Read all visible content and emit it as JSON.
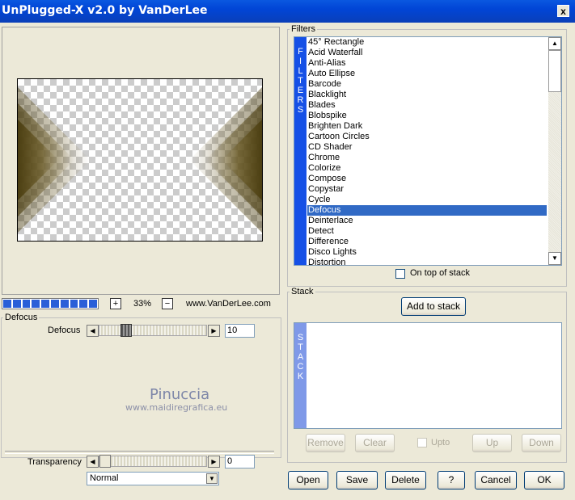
{
  "window": {
    "title": "UnPlugged-X v2.0 by VanDerLee",
    "close_label": "x"
  },
  "preview": {
    "zoom": "33%",
    "zoom_in": "+",
    "zoom_out": "−",
    "website": "www.VanDerLee.com",
    "progress_segments": 10
  },
  "params": {
    "group_label": "Defocus",
    "defocus": {
      "label": "Defocus",
      "value": "10"
    },
    "transparency": {
      "label": "Transparency",
      "value": "0"
    },
    "blend_mode": "Normal"
  },
  "watermark": {
    "name": "Pinuccia",
    "url": "www.maidiregrafica.eu"
  },
  "filters": {
    "group_label": "Filters",
    "strip_letters": [
      "F",
      "I",
      "L",
      "T",
      "E",
      "R",
      "S"
    ],
    "items": [
      "45° Rectangle",
      "Acid Waterfall",
      "Anti-Alias",
      "Auto Ellipse",
      "Barcode",
      "Blacklight",
      "Blades",
      "Blobspike",
      "Brighten Dark",
      "Cartoon Circles",
      "CD Shader",
      "Chrome",
      "Colorize",
      "Compose",
      "Copystar",
      "Cycle",
      "Defocus",
      "Deinterlace",
      "Detect",
      "Difference",
      "Disco Lights",
      "Distortion"
    ],
    "selected_index": 16,
    "on_top_label": "On top of stack"
  },
  "stack": {
    "group_label": "Stack",
    "add_label": "Add to stack",
    "strip_letters": [
      "S",
      "T",
      "A",
      "C",
      "K"
    ],
    "remove_label": "Remove",
    "clear_label": "Clear",
    "upto_label": "Upto",
    "up_label": "Up",
    "down_label": "Down"
  },
  "footer": {
    "open": "Open",
    "save": "Save",
    "delete": "Delete",
    "help": "?",
    "cancel": "Cancel",
    "ok": "OK"
  },
  "colors": {
    "title_bar": "#0145d6",
    "selection": "#316ac5",
    "filter_strip": "#1550e6",
    "stack_strip": "#7f99e8"
  }
}
